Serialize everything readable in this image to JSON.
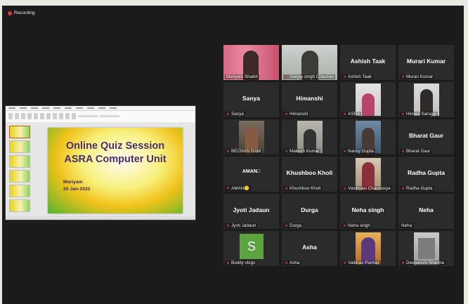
{
  "recording_label": "Recording",
  "slide": {
    "title_line1": "Online Quiz Session",
    "title_line2": "ASRA Computer Unit",
    "presenter": "Mariyam",
    "date": "25 Jan-2022"
  },
  "tiles": [
    {
      "label": "Mariyam Shaikh",
      "name": "",
      "muted": false
    },
    {
      "label": "Sanjay singh Chauhan",
      "name": "",
      "muted": true
    },
    {
      "label": "Ashish Taak",
      "name": "Ashish Taak",
      "muted": true
    },
    {
      "label": "Murari Kumar",
      "name": "Murari Kumar",
      "muted": true
    },
    {
      "label": "Sanya",
      "name": "Sanya",
      "muted": true
    },
    {
      "label": "Himanshi",
      "name": "Himanshi",
      "muted": true
    },
    {
      "label": "ASRA",
      "name": "",
      "muted": true
    },
    {
      "label": "Himani Saruggi",
      "name": "",
      "muted": true
    },
    {
      "label": "BECHAN RAM",
      "name": "",
      "muted": true
    },
    {
      "label": "Makesh Kumar",
      "name": "",
      "muted": true
    },
    {
      "label": "Nancy Gupta",
      "name": "",
      "muted": true
    },
    {
      "label": "Bharat Gaur",
      "name": "Bharat Gaur",
      "muted": true
    },
    {
      "label": "AMAN😶",
      "name": "AMAN□",
      "muted": true
    },
    {
      "label": "Khushboo Kholi",
      "name": "Khushboo Kholi",
      "muted": true
    },
    {
      "label": "Vaishnavi Chaurasiya",
      "name": "",
      "muted": true
    },
    {
      "label": "Radha Gupta",
      "name": "Radha Gupta",
      "muted": true
    },
    {
      "label": "Jyoti Jadaun",
      "name": "Jyoti Jadaun",
      "muted": true
    },
    {
      "label": "Durga",
      "name": "Durga",
      "muted": true
    },
    {
      "label": "Neha singh",
      "name": "Neha singh",
      "muted": true
    },
    {
      "label": "Neha",
      "name": "Neha",
      "muted": false
    },
    {
      "label": "Buddy vlogs",
      "name": "",
      "muted": true,
      "avatar": "S"
    },
    {
      "label": "Asha",
      "name": "Asha",
      "muted": true
    },
    {
      "label": "Vaibhav Parmar",
      "name": "",
      "muted": true
    },
    {
      "label": "Deepanshi Sharma",
      "name": "",
      "muted": true
    }
  ],
  "colors": {
    "background": "#1b1b1b",
    "tile": "#2b2b2b",
    "active_speaker": "#c6c83a",
    "muted_icon": "#e0453a",
    "slide_title": "#4a2d6d"
  },
  "icons": {
    "recording": "recording-dot-icon",
    "muted": "mic-muted-icon"
  }
}
